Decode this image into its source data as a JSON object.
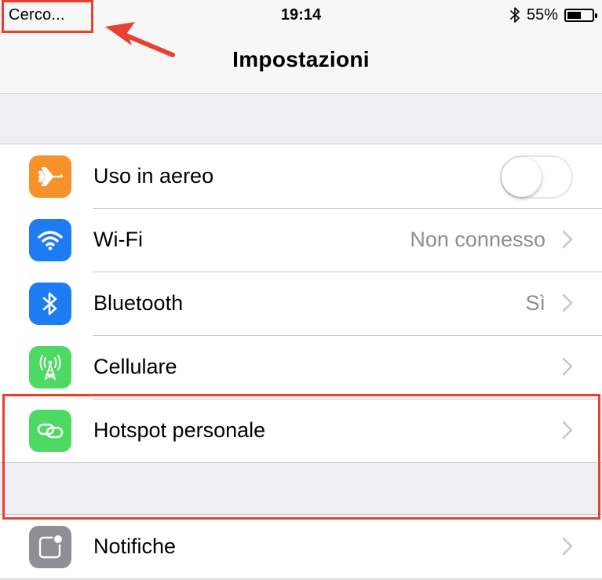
{
  "status_bar": {
    "carrier": "Cerco...",
    "time": "19:14",
    "battery_percent": "55%",
    "battery_level": 0.55,
    "bluetooth_icon": "bluetooth-icon"
  },
  "nav": {
    "title": "Impostazioni"
  },
  "settings": {
    "group1": [
      {
        "label": "Uso in aereo",
        "icon": "airplane-icon",
        "icon_color": "#f7922a",
        "control": "toggle",
        "on": false
      },
      {
        "label": "Wi-Fi",
        "value": "Non connesso",
        "icon": "wifi-icon",
        "icon_color": "#1e7cf2",
        "control": "chevron"
      },
      {
        "label": "Bluetooth",
        "value": "Sì",
        "icon": "bluetooth-icon",
        "icon_color": "#1e7cf2",
        "control": "chevron"
      },
      {
        "label": "Cellulare",
        "icon": "cellular-antenna-icon",
        "icon_color": "#4cd964",
        "control": "chevron"
      },
      {
        "label": "Hotspot personale",
        "icon": "hotspot-chain-icon",
        "icon_color": "#4cd964",
        "control": "chevron"
      }
    ],
    "group2": [
      {
        "label": "Notifiche",
        "icon": "notifications-icon",
        "icon_color": "#8e8e93",
        "control": "chevron"
      }
    ]
  },
  "annotations": {
    "highlight_color": "#e8412f"
  }
}
